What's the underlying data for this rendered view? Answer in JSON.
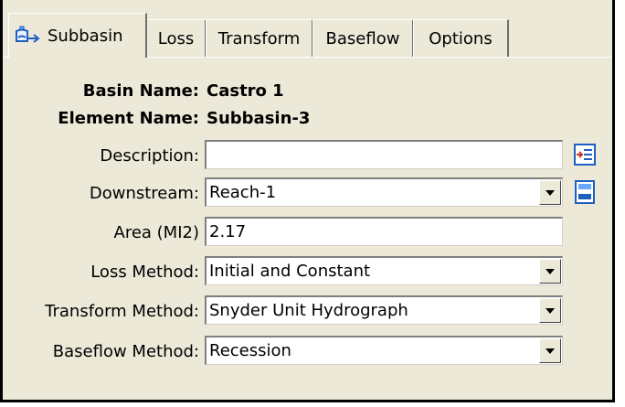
{
  "tabs": [
    {
      "label": "Subbasin",
      "icon": "subbasin-icon",
      "active": true
    },
    {
      "label": "Loss"
    },
    {
      "label": "Transform"
    },
    {
      "label": "Baseflow"
    },
    {
      "label": "Options"
    }
  ],
  "header": {
    "basin_label": "Basin Name:",
    "basin_value": "Castro 1",
    "element_label": "Element Name:",
    "element_value": "Subbasin-3"
  },
  "fields": {
    "description_label": "Description:",
    "description_value": "",
    "downstream_label": "Downstream:",
    "downstream_value": "Reach-1",
    "area_label": "Area (MI2)",
    "area_value": "2.17",
    "loss_label": "Loss Method:",
    "loss_value": "Initial and Constant",
    "transform_label": "Transform Method:",
    "transform_value": "Snyder Unit Hydrograph",
    "baseflow_label": "Baseflow Method:",
    "baseflow_value": "Recession"
  },
  "icons": {
    "description_button": "edit-description-icon",
    "downstream_button": "select-downstream-icon"
  },
  "colors": {
    "panel": "#ece9d8",
    "icon_blue": "#1f5fbf",
    "icon_red": "#c0392b"
  }
}
